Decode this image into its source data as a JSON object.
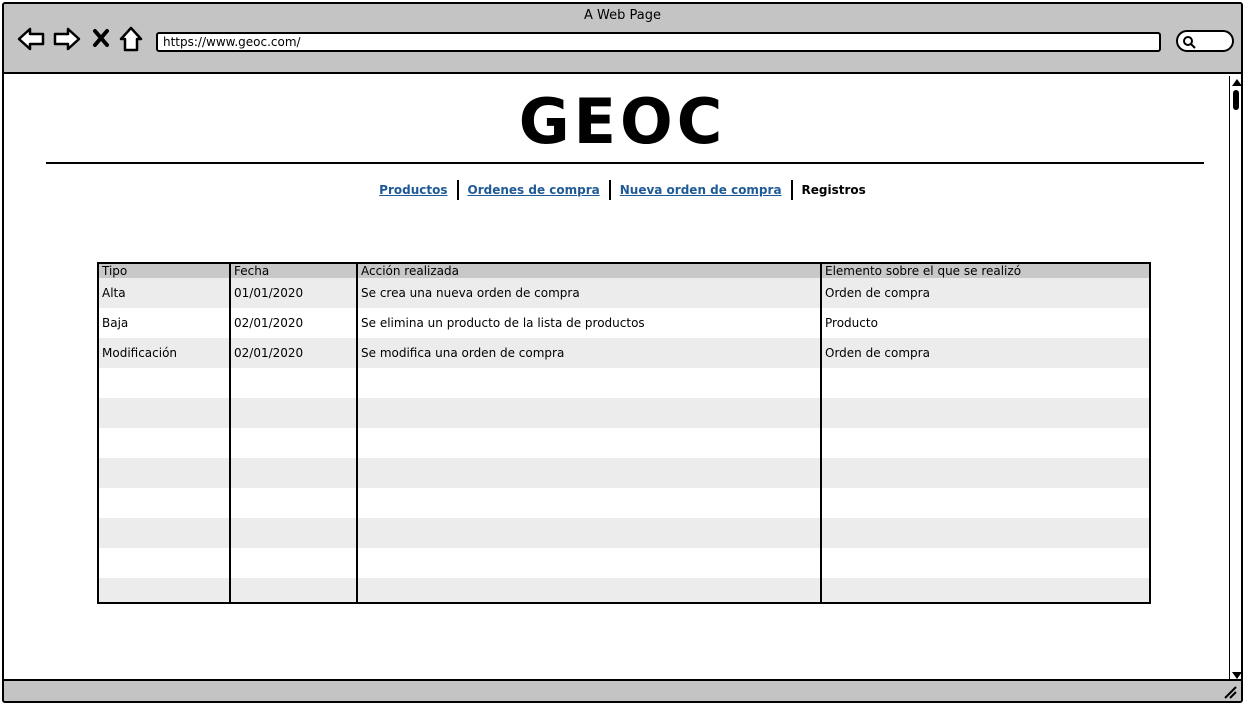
{
  "window": {
    "title": "A Web Page"
  },
  "toolbar": {
    "url": "https://www.geoc.com/",
    "icons": {
      "back": "back-arrow-icon",
      "forward": "forward-arrow-icon",
      "stop": "close-icon",
      "home": "home-icon",
      "search": "search-icon"
    }
  },
  "header": {
    "logo": "GEOC"
  },
  "nav": {
    "items": [
      {
        "label": "Productos",
        "active": false
      },
      {
        "label": "Ordenes de compra",
        "active": false
      },
      {
        "label": "Nueva orden de compra",
        "active": false
      },
      {
        "label": "Registros",
        "active": true
      }
    ]
  },
  "log_table": {
    "columns": [
      "Tipo",
      "Fecha",
      "Acción realizada",
      "Elemento sobre el que se realizó"
    ],
    "rows": [
      [
        "Alta",
        "01/01/2020",
        "Se crea una nueva orden de compra",
        "Orden de compra"
      ],
      [
        "Baja",
        "02/01/2020",
        "Se elimina un producto de la lista de productos",
        "Producto"
      ],
      [
        "Modificación",
        "02/01/2020",
        "Se modifica una orden de compra",
        "Orden de compra"
      ]
    ]
  },
  "colors": {
    "link": "#1f5a96",
    "chrome": "#c4c4c4",
    "header_row": "#c8c8c8",
    "stripe": "#ececec"
  }
}
